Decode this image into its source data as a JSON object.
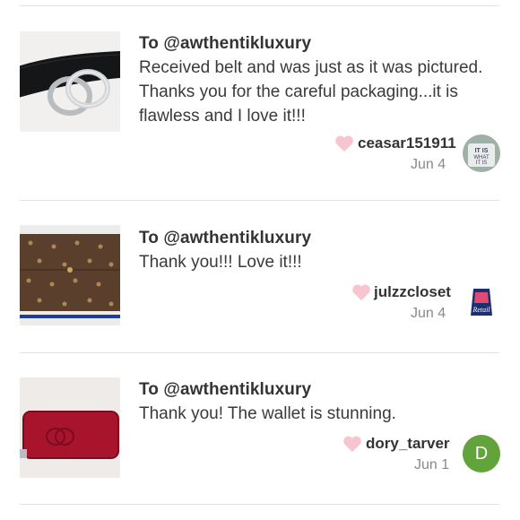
{
  "reviews": [
    {
      "recipient": "To @awthentikluxury",
      "message": "Received belt and was just as it was pictured. Thanks you for the careful packaging...it is flawless and I love it!!!",
      "username": "ceasar151911",
      "date": "Jun 4",
      "thumb_icon": "belt-image",
      "avatar_icon": "shirt-avatar",
      "avatar_text": "IT IS WHAT IT IS"
    },
    {
      "recipient": "To @awthentikluxury",
      "message": "Thank you!!! Love it!!!",
      "username": "julzzcloset",
      "date": "Jun 4",
      "thumb_icon": "monogram-wallet-image",
      "avatar_icon": "retail-logo-avatar",
      "avatar_text": "Retail"
    },
    {
      "recipient": "To @awthentikluxury",
      "message": "Thank you! The wallet is stunning.",
      "username": "dory_tarver",
      "date": "Jun 1",
      "thumb_icon": "red-wallet-image",
      "avatar_letter": "D",
      "avatar_color": "#63a33c"
    }
  ],
  "colors": {
    "heart": "#f7c5cf",
    "divider": "#e2e2e2",
    "date": "#8a8a8a"
  }
}
